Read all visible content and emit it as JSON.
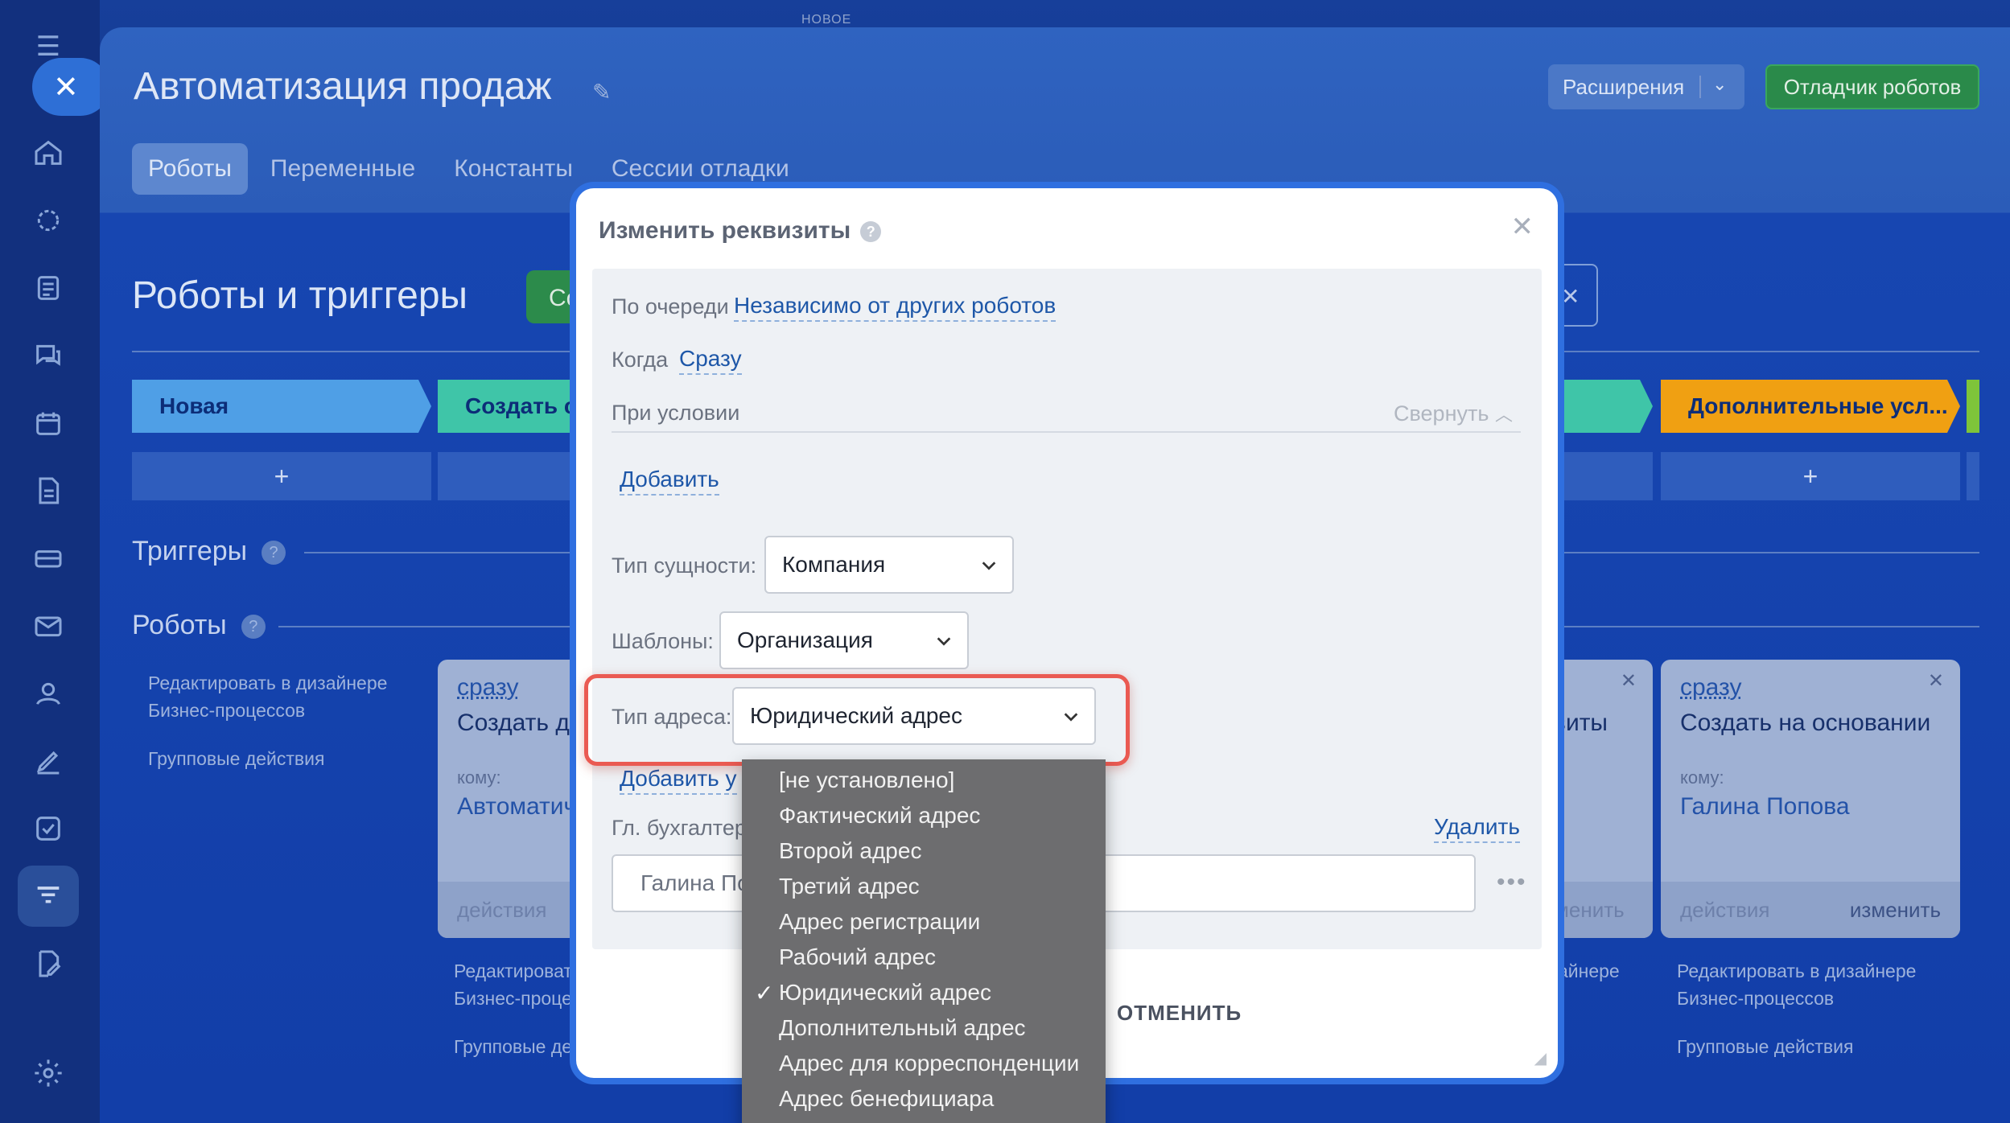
{
  "top_label": "НОВОЕ",
  "header": {
    "title": "Автоматизация продаж",
    "extensions_label": "Расширения",
    "debugger_label": "Отладчик роботов"
  },
  "tabs": [
    "Роботы",
    "Переменные",
    "Константы",
    "Сессии отладки"
  ],
  "section_title": "Роботы и триггеры",
  "green_button_partial": "Со",
  "stages": [
    "Новая",
    "Создать сч",
    "Дополнительные усл..."
  ],
  "plus_label": "+",
  "triggers_label": "Триггеры",
  "robots_label": "Роботы",
  "help_glyph": "?",
  "sidebar_links": {
    "edit_designer_1": "Редактировать в дизайнере",
    "edit_designer_2": "Бизнес-процессов",
    "group_actions": "Групповые действия"
  },
  "left_card_partial": {
    "when": "сразу",
    "name": "Создать до",
    "to_label": "кому:",
    "to_value": "Автоматич",
    "footer": "действия"
  },
  "right_card": {
    "when": "сразу",
    "name": "Создать на основании",
    "to_label": "кому:",
    "to_value": "Галина Попова",
    "footer_left": "действия",
    "footer_right": "изменить"
  },
  "middle_card_partial": {
    "name": "виты",
    "footer_right": "менить"
  },
  "under_cards": {
    "left_1": "Редактироват",
    "left_2": "Бизнес-процес",
    "left_3": "Групповые де",
    "mid_1": "айнере",
    "right_1": "Редактировать в дизайнере",
    "right_2": "Бизнес-процессов",
    "right_3": "Групповые действия"
  },
  "modal": {
    "title": "Изменить реквизиты",
    "queue_label": "По очереди",
    "queue_value": "Независимо от других роботов",
    "when_label": "Когда",
    "when_value": "Сразу",
    "condition_label": "При условии",
    "collapse_label": "Свернуть",
    "add_label": "Добавить",
    "entity_type_label": "Тип сущности:",
    "entity_type_value": "Компания",
    "templates_label": "Шаблоны:",
    "templates_value": "Организация",
    "address_type_label": "Тип адреса:",
    "address_type_value": "Юридический адрес",
    "add_condition_partial": "Добавить у",
    "accountant_label_partial": "Гл. бухгалтер",
    "delete_label": "Удалить",
    "accountant_value_partial": "Галина По",
    "more_label": "•••",
    "cancel_label": "ОТМЕНИТЬ"
  },
  "address_options": [
    "[не установлено]",
    "Фактический адрес",
    "Второй адрес",
    "Третий адрес",
    "Адрес регистрации",
    "Рабочий адрес",
    "Юридический адрес",
    "Дополнительный адрес",
    "Адрес для корреспонденции",
    "Адрес бенефициара"
  ],
  "selected_option_mark": "✓",
  "colors": {
    "accent_blue": "#2f6fe0",
    "highlight_red": "#ea5a52",
    "stage_new": "#4f9fe6",
    "stage_invoice": "#3fc5a8",
    "stage_extra": "#f0a012"
  }
}
